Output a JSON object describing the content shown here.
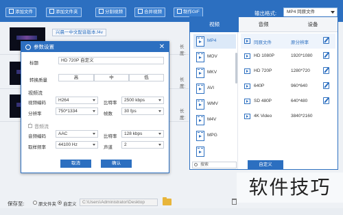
{
  "toolbar": {
    "add_file": "添加文件",
    "add_folder": "添加文件夹",
    "split_video": "分割视频",
    "merge_video": "合并视频",
    "make_gif": "制作GIF",
    "output_label": "输出格式:",
    "output_value": "MP4  同原文件"
  },
  "files": [
    {
      "name": "兴晨一中文配音版本.f4v",
      "side_label": "长度:"
    },
    {
      "name": "1",
      "side_label": "长度:"
    },
    {
      "name": "尖",
      "side_label": "长度:"
    }
  ],
  "dialog": {
    "title": "参数设置",
    "title_label": "标题",
    "title_value": "HD 720P 自定义",
    "quality_label": "转换质量",
    "quality_options": [
      "高",
      "中",
      "低"
    ],
    "video_section": "视频流",
    "video_codec_label": "视频编码",
    "video_codec_value": "H264",
    "bitrate_label": "比特率",
    "video_bitrate_value": "2500 kbps",
    "resolution_label": "分辨率",
    "resolution_value": "750*1334",
    "fps_label": "帧数",
    "fps_value": "30 fps",
    "audio_section": "音频流",
    "audio_codec_label": "音频编码",
    "audio_codec_value": "AAC",
    "audio_bitrate_value": "128 kbps",
    "sample_rate_label": "取样频率",
    "sample_rate_value": "44100 Hz",
    "channel_label": "声道",
    "channel_value": "2",
    "cancel": "取消",
    "confirm": "确认"
  },
  "format_panel": {
    "tabs": [
      "视频",
      "音频",
      "设备"
    ],
    "formats": [
      "MP4",
      "MOV",
      "MKV",
      "AVI",
      "WMV",
      "M4V",
      "MPG"
    ],
    "search_placeholder": "搜索",
    "presets": [
      {
        "name": "同原文件",
        "res": "原分辨率"
      },
      {
        "name": "HD 1080P",
        "res": "1920*1080"
      },
      {
        "name": "HD 720P",
        "res": "1280*720"
      },
      {
        "name": "640P",
        "res": "960*640"
      },
      {
        "name": "SD 480P",
        "res": "640*480"
      },
      {
        "name": "4K Video",
        "res": "3840*2160"
      }
    ],
    "custom_button": "自定义"
  },
  "footer": {
    "save_to": "保存至:",
    "option_original": "原文件夹",
    "option_custom": "自定义",
    "path": "C:\\Users\\Administrator\\Desktop"
  },
  "watermark": "软件技巧"
}
